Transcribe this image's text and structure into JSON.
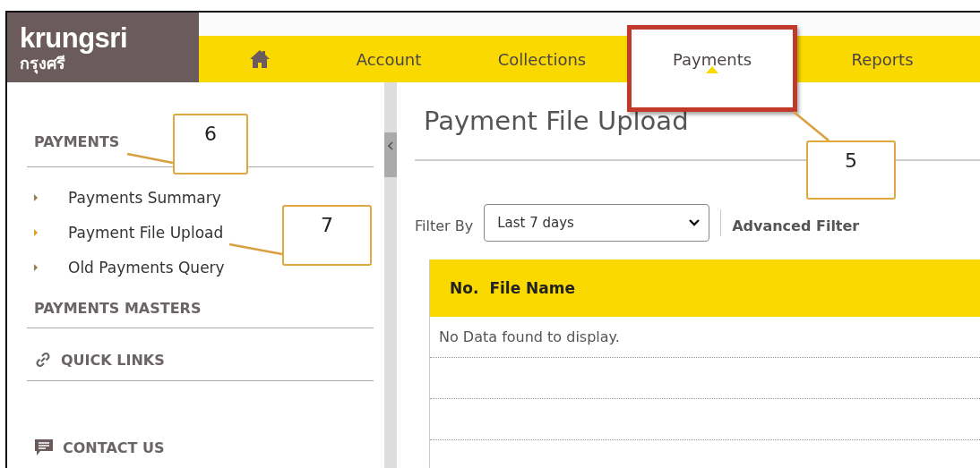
{
  "logo": {
    "name": "krungsri",
    "subtitle": "กรุงศรี"
  },
  "nav": [
    {
      "kind": "home",
      "selected": false,
      "highlighted": false
    },
    {
      "kind": "text",
      "label": "Account",
      "selected": false,
      "highlighted": false
    },
    {
      "kind": "text",
      "label": "Collections",
      "selected": false,
      "highlighted": false
    },
    {
      "kind": "text",
      "label": "Payments",
      "selected": true,
      "highlighted": true
    },
    {
      "kind": "text",
      "label": "Reports",
      "selected": false,
      "highlighted": false
    }
  ],
  "sidebar": {
    "sections": [
      {
        "kind": "plain",
        "title": "PAYMENTS",
        "items": [
          {
            "label": "Payments Summary",
            "selected": false
          },
          {
            "label": "Payment File Upload",
            "selected": true
          },
          {
            "label": "Old Payments Query",
            "selected": false
          }
        ]
      },
      {
        "kind": "plain",
        "title": "PAYMENTS MASTERS"
      },
      {
        "kind": "links",
        "title": "QUICK LINKS"
      },
      {
        "kind": "contact",
        "title": "CONTACT US"
      }
    ]
  },
  "page": {
    "title": "Payment File Upload",
    "filter": {
      "label": "Filter By",
      "value": "Last 7 days",
      "advanced": "Advanced Filter"
    },
    "table": {
      "columns": [
        "No.",
        "File Name"
      ],
      "empty_message": "No Data found to display."
    }
  },
  "annotations": [
    {
      "label": "5"
    },
    {
      "label": "6"
    },
    {
      "label": "7"
    }
  ]
}
